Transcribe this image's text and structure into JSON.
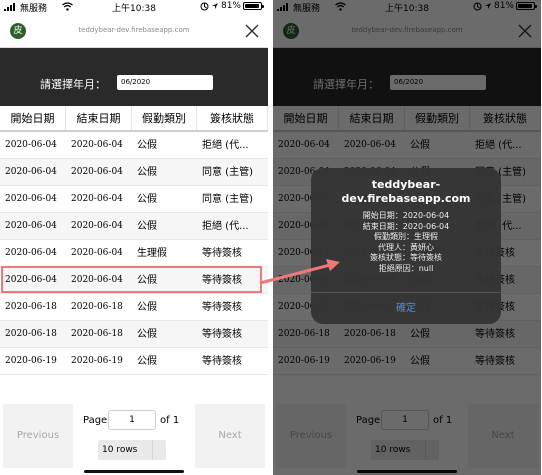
{
  "status_bar": {
    "carrier": "無服務",
    "time": "上午10:38",
    "battery": "81%",
    "battery_level": 0.81
  },
  "browser": {
    "url": "teddybear-dev.firebaseapp.com",
    "logo_text": "皮"
  },
  "picker": {
    "label": "請選擇年月：",
    "value": "06/2020"
  },
  "table": {
    "headers": [
      "開始日期",
      "結束日期",
      "假勤類別",
      "簽核狀態"
    ],
    "rows": [
      [
        "2020-06-04",
        "2020-06-04",
        "公假",
        "拒絕 (代..."
      ],
      [
        "2020-06-04",
        "2020-06-04",
        "公假",
        "同意 (主管)"
      ],
      [
        "2020-06-04",
        "2020-06-04",
        "公假",
        "同意 (主管)"
      ],
      [
        "2020-06-04",
        "2020-06-04",
        "公假",
        "拒絕 (代..."
      ],
      [
        "2020-06-04",
        "2020-06-04",
        "生理假",
        "等待簽核"
      ],
      [
        "2020-06-04",
        "2020-06-04",
        "公假",
        "等待簽核"
      ],
      [
        "2020-06-18",
        "2020-06-18",
        "公假",
        "等待簽核"
      ],
      [
        "2020-06-18",
        "2020-06-18",
        "公假",
        "等待簽核"
      ],
      [
        "2020-06-19",
        "2020-06-19",
        "公假",
        "等待簽核"
      ]
    ],
    "highlighted_row": 4
  },
  "pager": {
    "previous": "Previous",
    "next": "Next",
    "page_label": "Page",
    "page_value": "1",
    "of_label": "of 1",
    "rows_select": "10 rows"
  },
  "alert": {
    "title_line1": "teddybear-",
    "title_line2": "dev.firebaseapp.com",
    "lines": [
      "開始日期：2020-06-04",
      "結束日期：2020-06-04",
      "假勤類別：生理假",
      "代理人：黃妍心",
      "簽核狀態：等待簽核",
      "拒絕原因：null"
    ],
    "ok": "確定"
  },
  "colors": {
    "highlight": "#f07878",
    "alert_button": "#4a8fe0",
    "dark_header": "#2a2a2a"
  },
  "icons": [
    "signal-icon",
    "wifi-icon",
    "location-icon",
    "battery-icon",
    "close-icon",
    "arrow-icon"
  ]
}
